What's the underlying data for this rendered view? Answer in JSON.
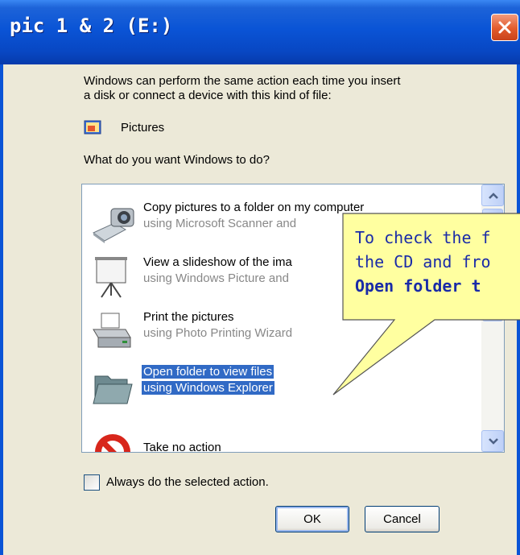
{
  "window": {
    "title": "pic 1 & 2 (E:)",
    "close_icon": "close-x-icon"
  },
  "intro": {
    "line1": "Windows can perform the same action each time you insert",
    "line2": "a disk or connect a device with this kind of file:"
  },
  "content_type": {
    "icon": "pictures-icon",
    "label": "Pictures"
  },
  "question": "What do you want Windows to do?",
  "actions": [
    {
      "icon": "camera-scanner-icon",
      "title": "Copy pictures to a folder on my computer",
      "subtitle": "using Microsoft Scanner and"
    },
    {
      "icon": "projector-screen-icon",
      "title": "View a slideshow of the ima",
      "subtitle": "using Windows Picture and"
    },
    {
      "icon": "printer-icon",
      "title": "Print the pictures",
      "subtitle": "using Photo Printing Wizard"
    },
    {
      "icon": "folder-icon",
      "title": "Open folder to view files",
      "subtitle": "using Windows Explorer",
      "selected": true
    },
    {
      "icon": "no-action-icon",
      "title": "Take no action",
      "subtitle": ""
    }
  ],
  "always_checkbox": {
    "label": "Always do the selected action.",
    "checked": false
  },
  "buttons": {
    "ok": "OK",
    "cancel": "Cancel"
  },
  "callout": {
    "line1": "To check the f",
    "line2": "the CD and fro",
    "line3": "Open folder t"
  },
  "colors": {
    "titlebar_blue": "#0a54d6",
    "selection_blue": "#316ac5",
    "callout_fill": "#ffffa0",
    "callout_text": "#1a2ba8"
  }
}
